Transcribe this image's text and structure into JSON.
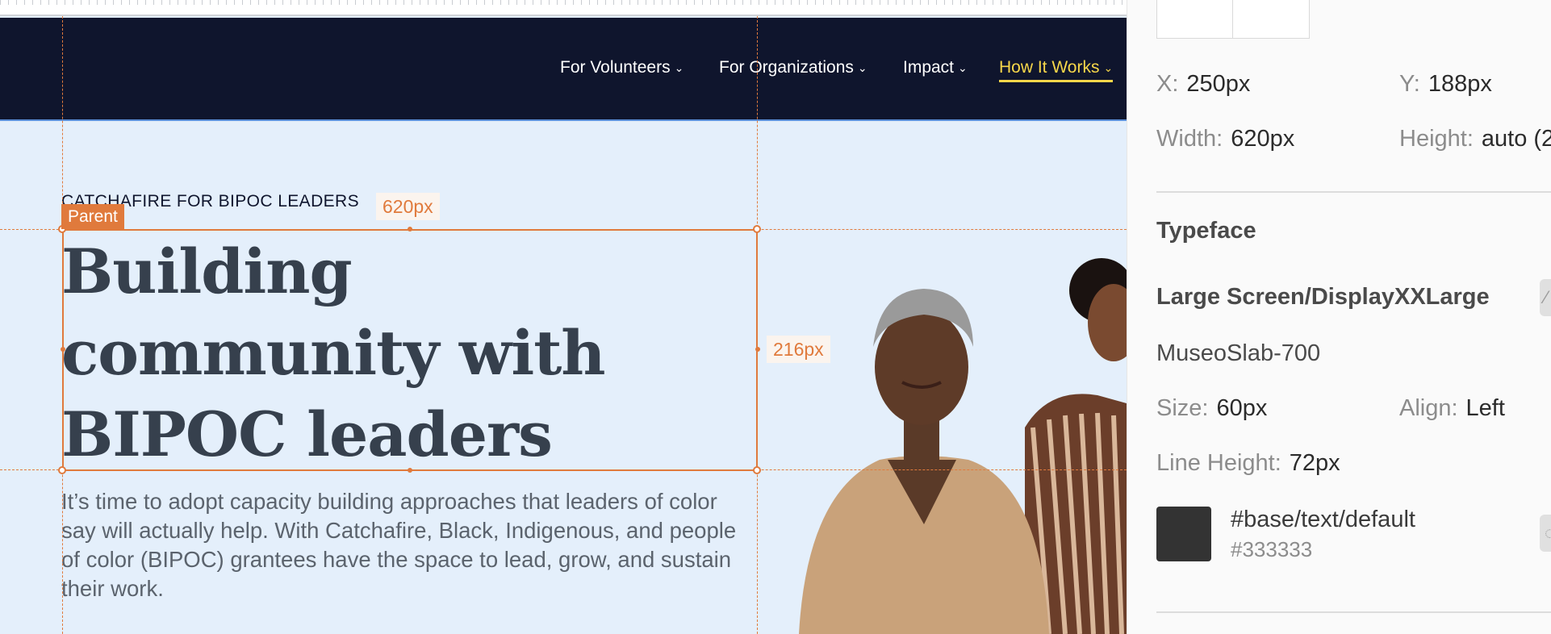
{
  "site": {
    "nav": [
      {
        "label": "For Volunteers",
        "active": false
      },
      {
        "label": "For Organizations",
        "active": false
      },
      {
        "label": "Impact",
        "active": false
      },
      {
        "label": "How It Works",
        "active": true
      }
    ],
    "chevron": "⌄",
    "eyebrow": "CATCHAFIRE FOR BIPOC LEADERS",
    "headline": [
      "Building",
      "community with",
      "BIPOC leaders"
    ],
    "body": "It’s time to adopt capacity building approaches that leaders of color say will actually help. With Catchafire, Black, Indigenous, and people of color (BIPOC) grantees have the space to lead, grow, and sustain their work."
  },
  "overlay": {
    "parent_tag": "Parent",
    "width_label": "620px",
    "height_label": "216px"
  },
  "inspector": {
    "x": {
      "label": "X:",
      "value": "250px"
    },
    "y": {
      "label": "Y:",
      "value": "188px"
    },
    "width": {
      "label": "Width:",
      "value": "620px"
    },
    "height": {
      "label": "Height:",
      "value": "auto (2"
    },
    "section_title": "Typeface",
    "style_name": "Large Screen/DisplayXXLarge",
    "font_name": "MuseoSlab-700",
    "size": {
      "label": "Size:",
      "value": "60px"
    },
    "align": {
      "label": "Align:",
      "value": "Left"
    },
    "line_height": {
      "label": "Line Height:",
      "value": "72px"
    },
    "color_token": "#base/text/default",
    "color_hex": "#333333"
  },
  "colors": {
    "nav_bg": "#0f152d",
    "hero_bg": "#e4effb",
    "accent": "#e07a3c",
    "active_nav": "#f7d74a",
    "swatch": "#333333"
  }
}
